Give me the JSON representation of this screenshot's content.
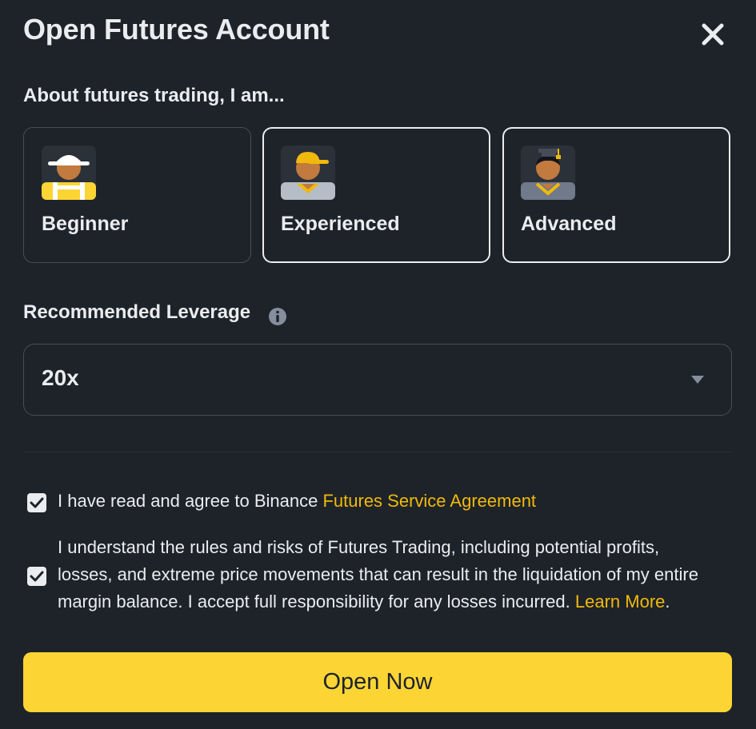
{
  "modal": {
    "title": "Open Futures Account"
  },
  "experience": {
    "label": "About futures trading, I am...",
    "options": [
      {
        "label": "Beginner",
        "avatar_icon": "beginner-avatar-icon"
      },
      {
        "label": "Experienced",
        "avatar_icon": "experienced-avatar-icon"
      },
      {
        "label": "Advanced",
        "avatar_icon": "advanced-avatar-icon"
      }
    ]
  },
  "leverage": {
    "label": "Recommended Leverage",
    "value": "20x"
  },
  "agreements": {
    "service": {
      "checked": true,
      "text": "I have read and agree to Binance ",
      "link": "Futures Service Agreement"
    },
    "risk": {
      "checked": true,
      "line1": "I understand the rules and risks of Futures Trading, including potential profits,",
      "line2": "losses, and extreme price movements that can result in the liquidation of my entire",
      "line3": "margin balance. I accept full responsibility for any losses incurred. ",
      "link": "Learn More",
      "end": "."
    }
  },
  "actions": {
    "open_label": "Open Now"
  },
  "colors": {
    "background": "#1e2329",
    "accent": "#fcd535",
    "link": "#f0b90b",
    "text": "#eaecef",
    "border": "#474d57"
  }
}
